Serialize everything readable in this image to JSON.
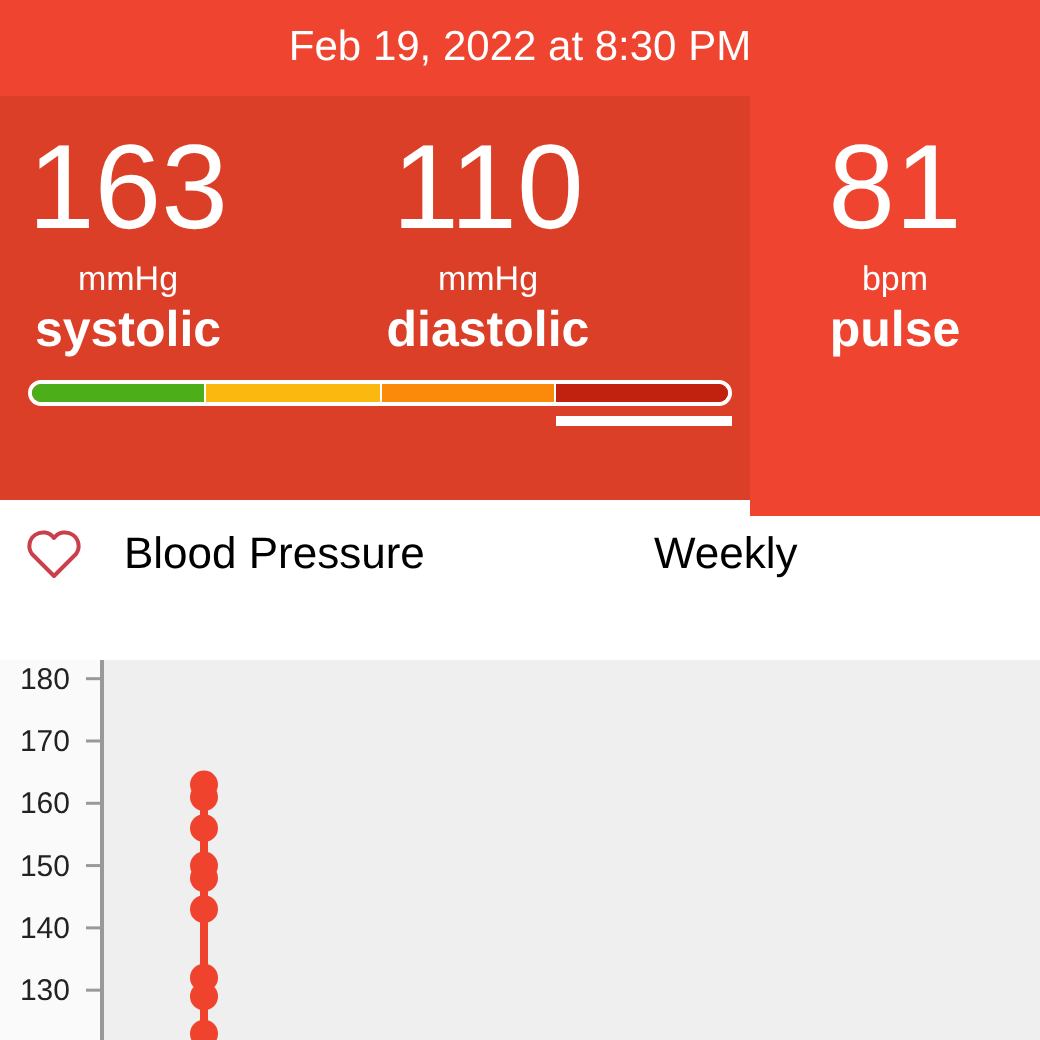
{
  "header": {
    "date": "Feb 19, 2022 at 8:30 PM"
  },
  "readings": [
    {
      "value": "163",
      "unit": "mmHg",
      "label": "systolic"
    },
    {
      "value": "110",
      "unit": "mmHg",
      "label": "diastolic"
    }
  ],
  "pulse": {
    "value": "81",
    "unit": "bpm",
    "label": "pulse"
  },
  "gauge": [
    {
      "color": "#4caf1a",
      "selected": false
    },
    {
      "color": "#fbb90f",
      "selected": false
    },
    {
      "color": "#fb8a0a",
      "selected": false
    },
    {
      "color": "#c1220f",
      "selected": true
    }
  ],
  "section": {
    "title": "Blood Pressure",
    "period": "Weekly"
  },
  "chart_data": {
    "type": "scatter",
    "ylim": [
      122,
      183
    ],
    "yticks": [
      130,
      140,
      150,
      160,
      170,
      180
    ],
    "series": [
      {
        "color": "#f0432e",
        "values": [
          163,
          161,
          null,
          156,
          150,
          148,
          143,
          132,
          129,
          123
        ]
      }
    ]
  }
}
